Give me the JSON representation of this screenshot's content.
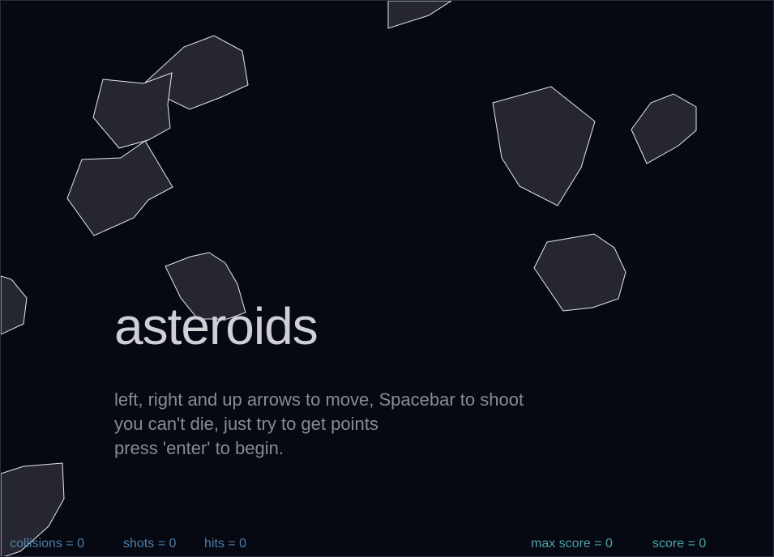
{
  "game": {
    "title": "asteroids",
    "instructions": [
      "left, right and up arrows to move, Spacebar to shoot",
      "you can't die, just try to get points",
      "press 'enter' to begin."
    ]
  },
  "hud": {
    "collisions": "collisions = 0",
    "shots": "shots = 0",
    "hits": "hits = 0",
    "max_score": "max score = 0",
    "score": "score = 0"
  },
  "colors": {
    "background": "#060812",
    "asteroid_fill": "#25262f",
    "asteroid_stroke": "#e8e8ee",
    "title": "#cfcfd4",
    "instructions": "#8a8b92",
    "hud_left": "#4f7fa8",
    "hud_right": "#4fa2a4"
  }
}
